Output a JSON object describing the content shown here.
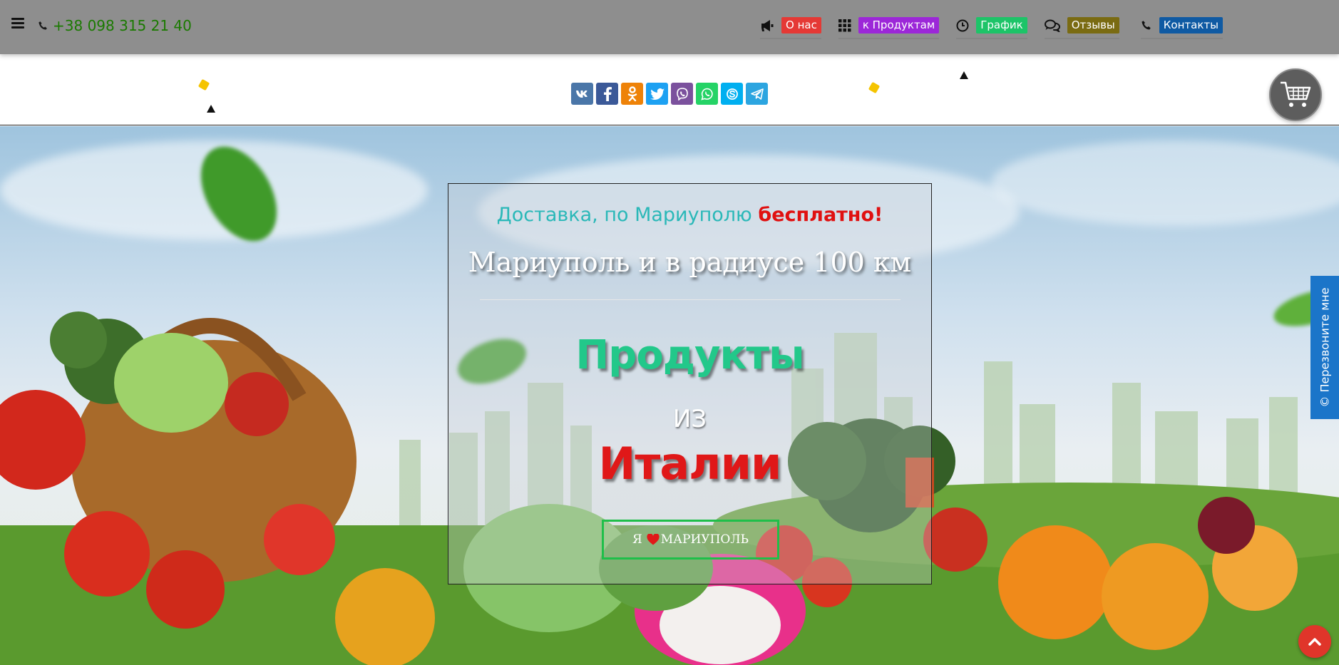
{
  "header": {
    "phone": "+38 098 315 21 40",
    "nav": [
      {
        "label": "О нас",
        "color": "#e53935",
        "icon": "megaphone-icon"
      },
      {
        "label": "к Продуктам",
        "color": "#9c27d8",
        "icon": "grid-icon"
      },
      {
        "label": "График",
        "color": "#1dc468",
        "icon": "clock-icon"
      },
      {
        "label": "Отзывы",
        "color": "#7a6b12",
        "icon": "comments-icon"
      },
      {
        "label": "Контакты",
        "color": "#0f5aa3",
        "icon": "phone-icon"
      }
    ]
  },
  "share": [
    {
      "name": "vk",
      "glyph": "vk",
      "color": "#4a76a8"
    },
    {
      "name": "facebook",
      "glyph": "f",
      "color": "#3b5998"
    },
    {
      "name": "odnoklassniki",
      "glyph": "ok",
      "color": "#ee8208"
    },
    {
      "name": "twitter",
      "glyph": "t",
      "color": "#1da1f2"
    },
    {
      "name": "viber",
      "glyph": "v",
      "color": "#7b519d"
    },
    {
      "name": "whatsapp",
      "glyph": "w",
      "color": "#25d366"
    },
    {
      "name": "skype",
      "glyph": "s",
      "color": "#00aff0"
    },
    {
      "name": "telegram",
      "glyph": "tg",
      "color": "#2ca5e0"
    }
  ],
  "hero": {
    "delivery_text": "Доставка, по Мариуполю",
    "delivery_free": "бесплатно!",
    "radius_text": "Мариуполь и в радиусе 100 км",
    "products_word": "Продукты",
    "from_word": "ИЗ",
    "italy_word": "Италии",
    "love_prefix": "Я",
    "love_city": "МАРИУПОЛЬ"
  },
  "callback": {
    "label": "© Перезвоните мне"
  }
}
